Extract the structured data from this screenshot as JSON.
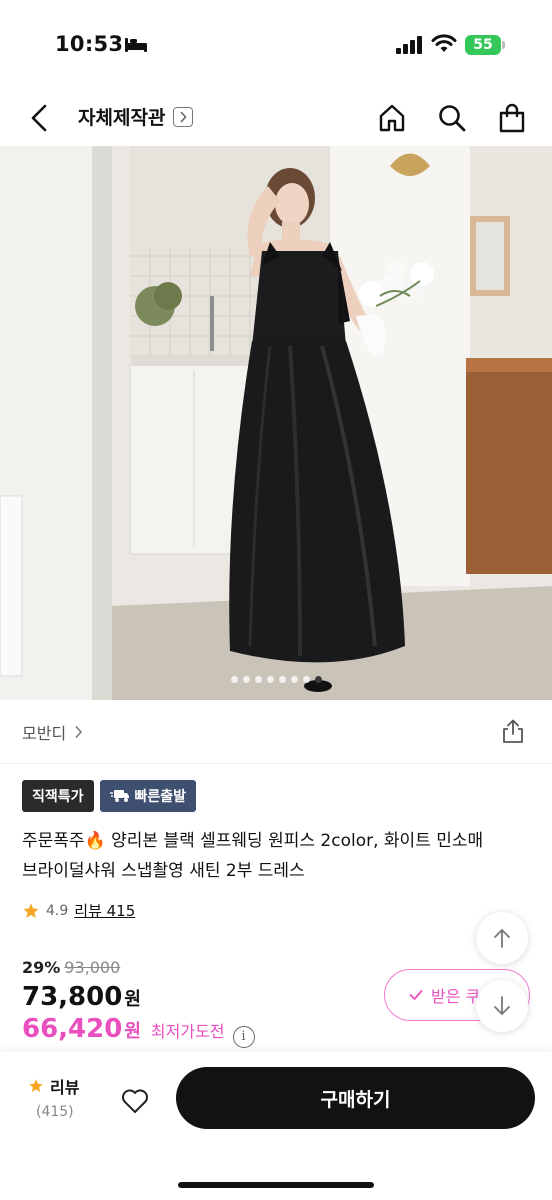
{
  "status_bar": {
    "time": "10:53",
    "battery": "55"
  },
  "header": {
    "shop_name": "자체제작관"
  },
  "hero": {
    "total_images": 8,
    "active_index": 7
  },
  "brand": {
    "name": "모반디"
  },
  "badges": {
    "first": "직잭특가",
    "second": "빠른출발"
  },
  "product": {
    "title": "주문폭주🔥 양리본 블랙 셀프웨딩 원피스 2color, 화이트 민소매 브라이덜샤워 스냅촬영 새틴 2부 드레스",
    "rating": "4.9",
    "review_link": "리뷰 415"
  },
  "price": {
    "discount_pct": "29%",
    "original": "93,000",
    "sale": "73,800",
    "currency": "원",
    "lowest": "66,420",
    "lowest_label": "최저가도전",
    "info_symbol": "i"
  },
  "coupon": {
    "label": "받은 쿠"
  },
  "bottom_bar": {
    "review_label": "리뷰",
    "review_count": "(415)",
    "buy_label": "구매하기"
  },
  "colors": {
    "accent_pink": "#e94fbf",
    "star": "#f5a623",
    "buy_button": "#121212",
    "battery": "#34c759"
  }
}
